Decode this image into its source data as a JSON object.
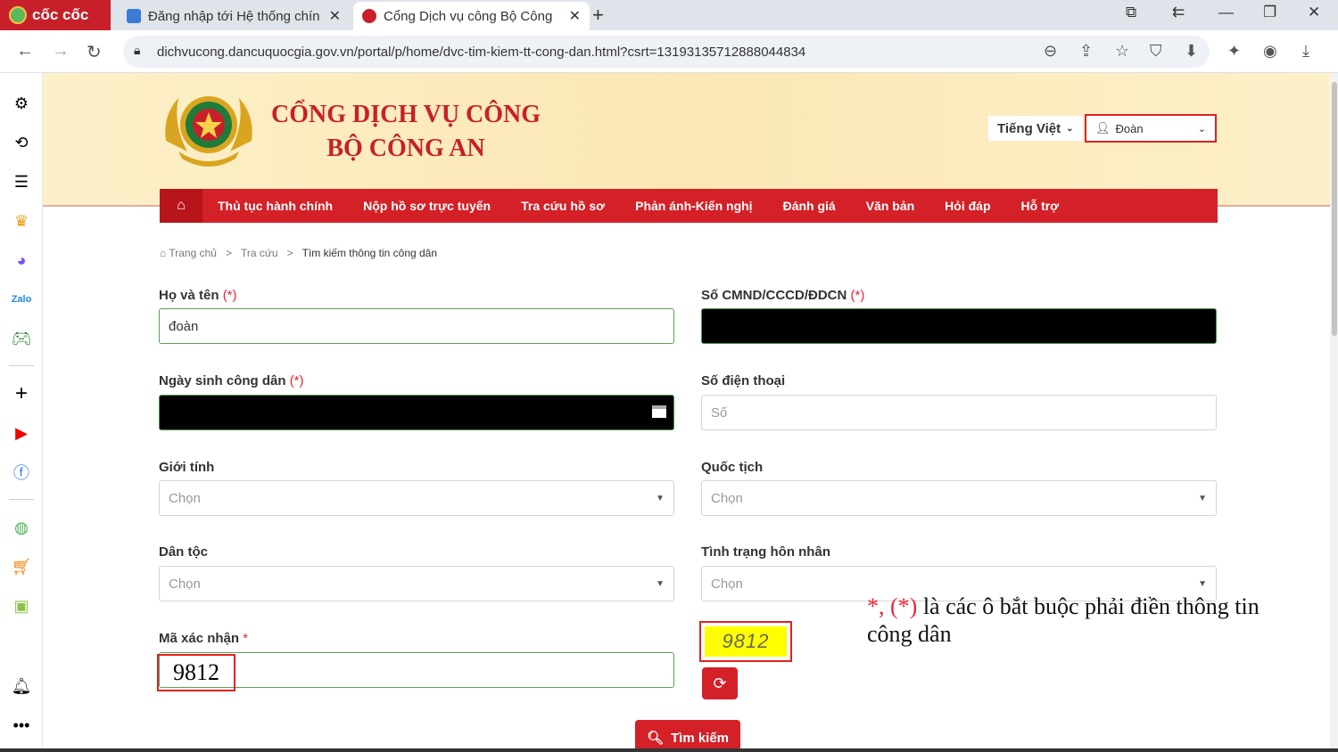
{
  "browser": {
    "brand": "cốc cốc",
    "tabs": [
      {
        "title": "Đăng nhập tới Hệ thống chín"
      },
      {
        "title": "Cổng Dịch vụ công Bộ Công"
      }
    ],
    "url": "dichvucong.dancuquocgia.gov.vn/portal/p/home/dvc-tim-kiem-tt-cong-dan.html?csrt=13193135712888044834"
  },
  "header": {
    "brand_line1": "CỔNG DỊCH VỤ CÔNG",
    "brand_line2": "BỘ CÔNG AN",
    "language": "Tiếng Việt",
    "user": "Đoàn"
  },
  "menu": {
    "items": [
      "Thủ tục hành chính",
      "Nộp hồ sơ trực tuyến",
      "Tra cứu hồ sơ",
      "Phản ánh-Kiến nghị",
      "Đánh giá",
      "Văn bản",
      "Hỏi đáp",
      "Hỗ trợ"
    ]
  },
  "breadcrumb": {
    "home": "Trang chủ",
    "sep": ">",
    "level2": "Tra cứu",
    "current": "Tìm kiếm thông tin công dân"
  },
  "form": {
    "required_mark": "(*)",
    "name_label": "Họ và tên",
    "name_value": "đoàn",
    "id_label": "Số CMND/CCCD/ĐDCN",
    "dob_label": "Ngày sinh công dân",
    "phone_label": "Số điện thoại",
    "phone_placeholder": "Số",
    "gender_label": "Giới tính",
    "gender_value": "Chọn",
    "nationality_label": "Quốc tịch",
    "nationality_value": "Chọn",
    "ethnicity_label": "Dân tộc",
    "ethnicity_value": "Chọn",
    "marital_label": "Tình trạng hôn nhân",
    "marital_value": "Chọn",
    "captcha_label": "Mã xác nhận",
    "captcha_star": "*",
    "captcha_input": "9812",
    "captcha_image": "9812",
    "search_button": "Tìm kiếm"
  },
  "annotation": {
    "marks": "*, (*)",
    "text": " là các ô bắt buộc phải điền thông tin công dân"
  },
  "colors": {
    "brand_red": "#d42027",
    "banner_bg": "#fdf0c9",
    "highlight": "#ffff00"
  }
}
